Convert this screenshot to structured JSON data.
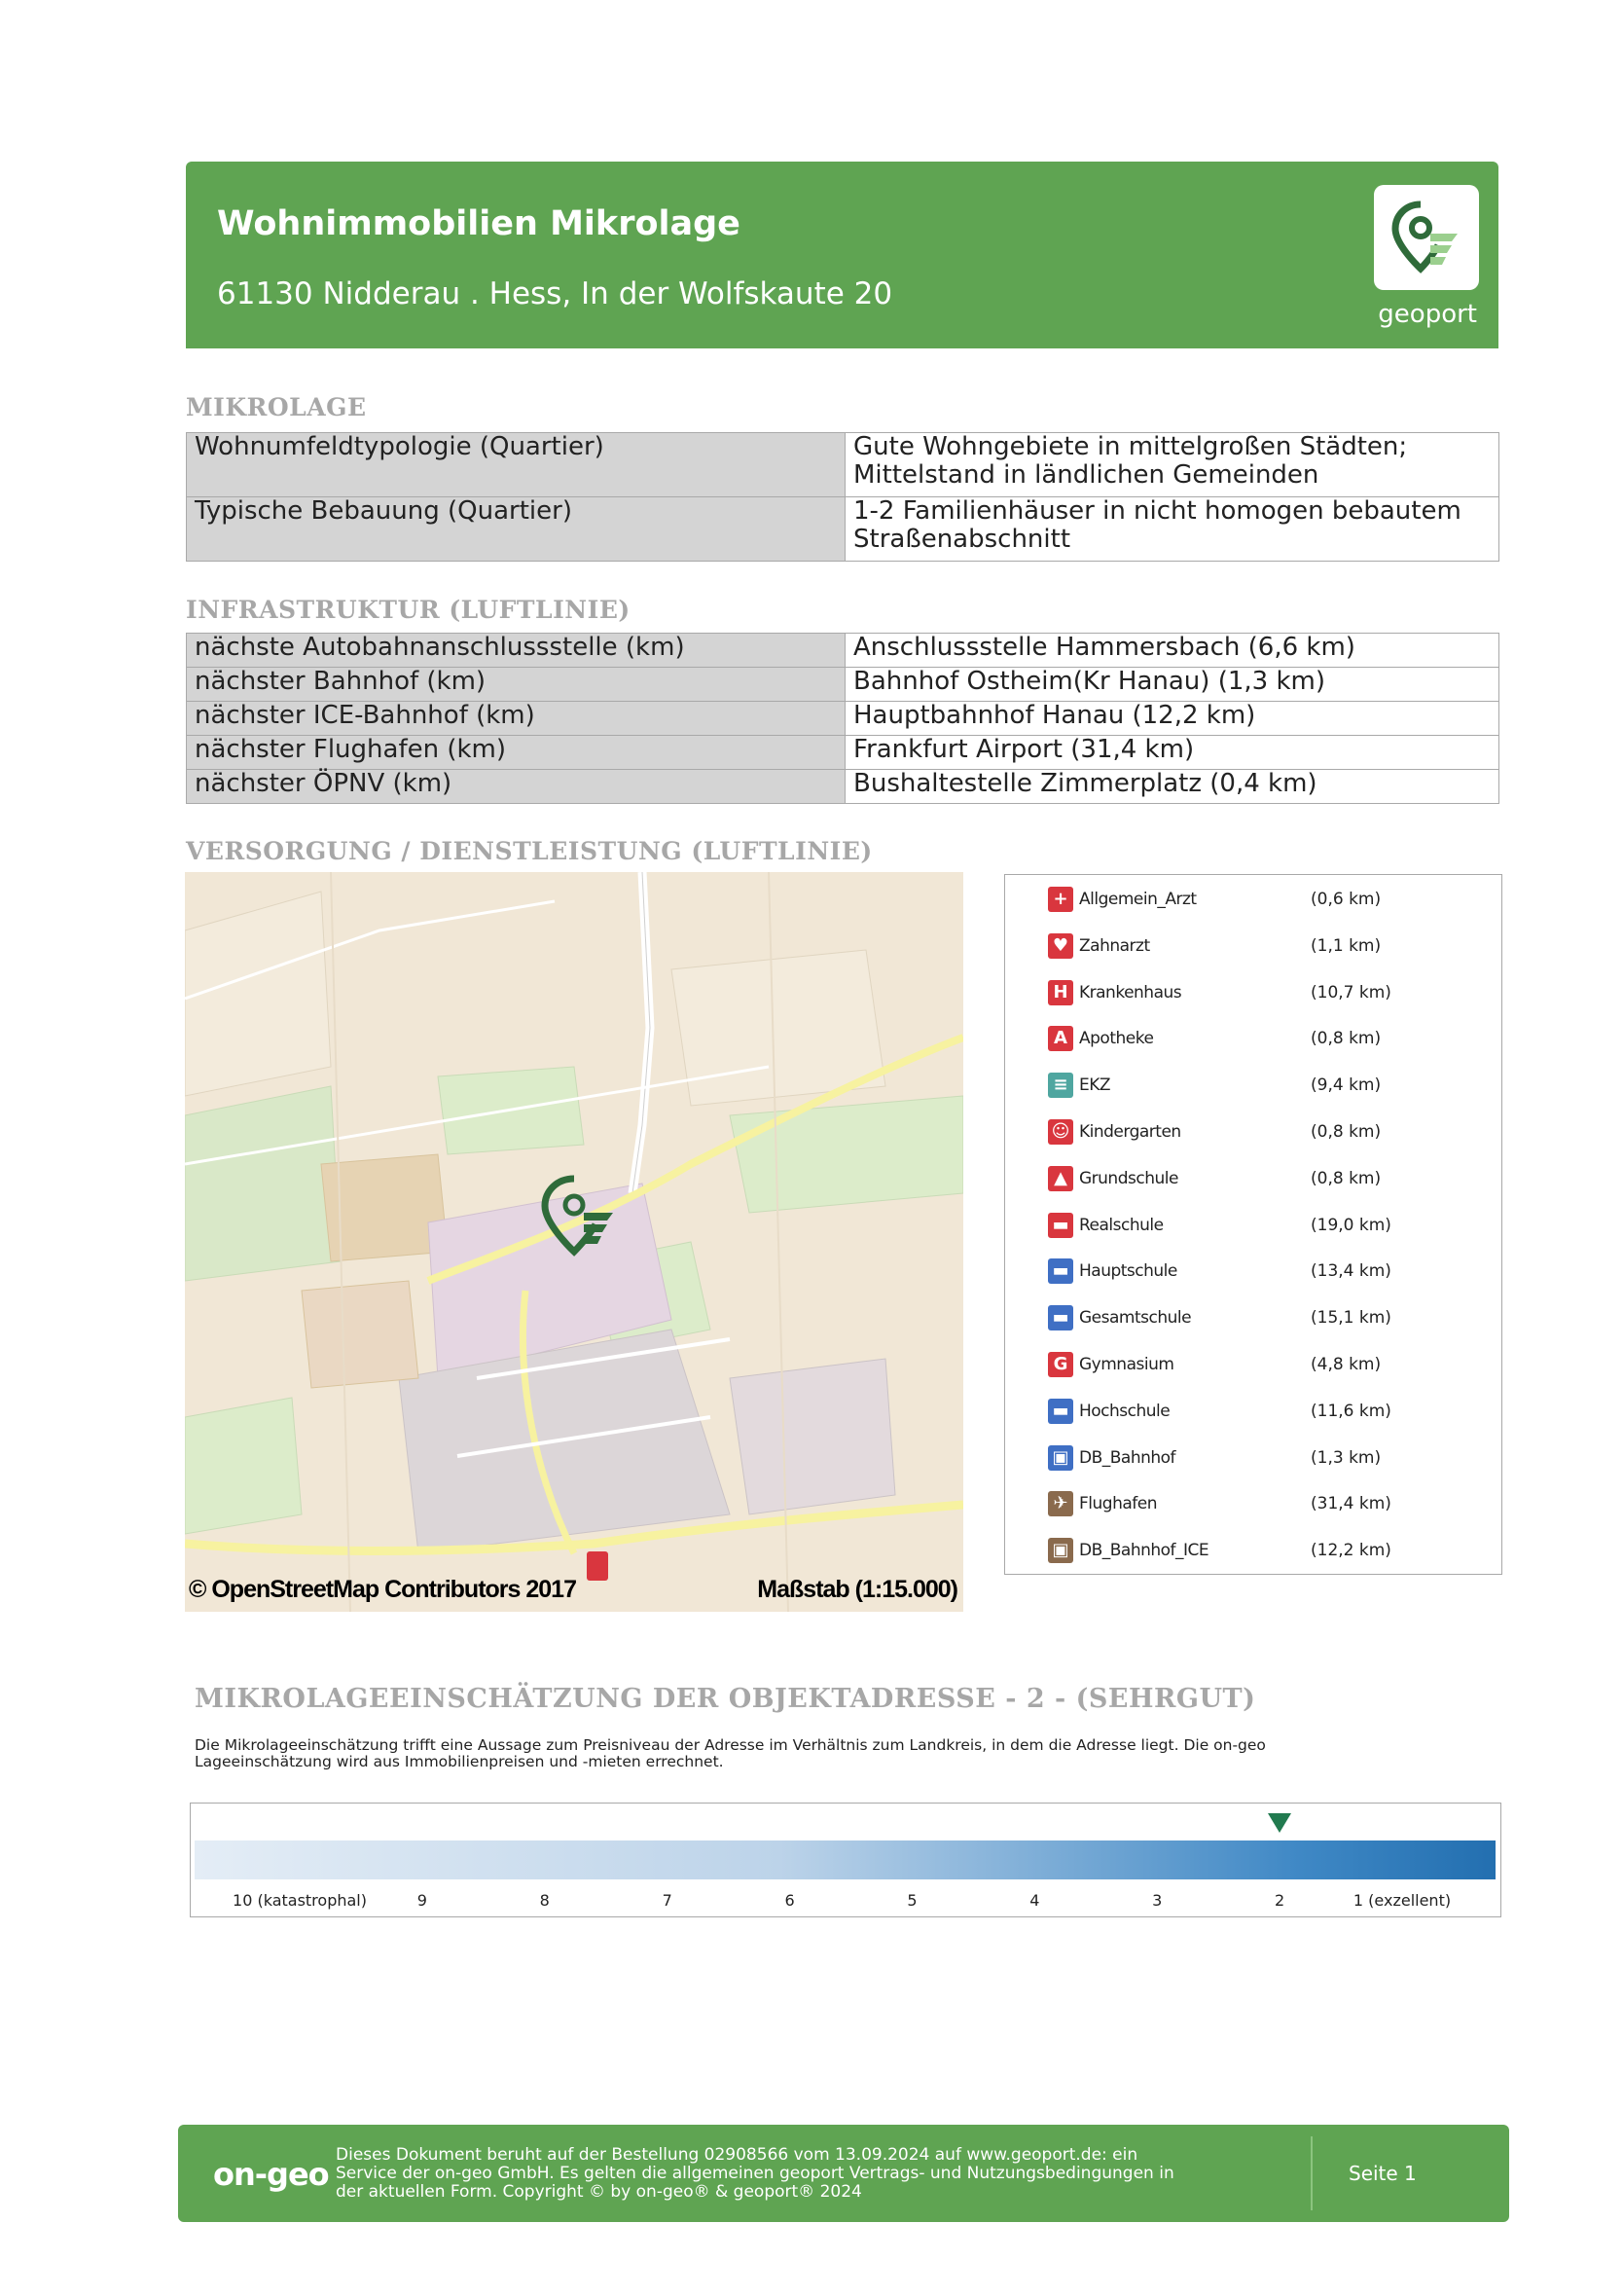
{
  "header": {
    "title": "Wohnimmobilien Mikrolage",
    "address": "61130 Nidderau . Hess, In der Wolfskaute 20",
    "logo_text": "geoport"
  },
  "mikrolage": {
    "heading": "MIKROLAGE",
    "rows": [
      {
        "key": "Wohnumfeldtypologie (Quartier)",
        "value_l1": "Gute Wohngebiete in mittelgroßen Städten;",
        "value_l2": "Mittelstand in ländlichen Gemeinden"
      },
      {
        "key": "Typische Bebauung (Quartier)",
        "value_l1": "1-2 Familienhäuser in nicht homogen bebautem",
        "value_l2": "Straßenabschnitt"
      }
    ]
  },
  "infrastruktur": {
    "heading": "INFRASTRUKTUR (LUFTLINIE)",
    "rows": [
      {
        "key": "nächste Autobahnanschlussstelle (km)",
        "value": "Anschlussstelle Hammersbach (6,6 km)"
      },
      {
        "key": "nächster Bahnhof (km)",
        "value": "Bahnhof Ostheim(Kr Hanau) (1,3 km)"
      },
      {
        "key": "nächster ICE-Bahnhof (km)",
        "value": "Hauptbahnhof Hanau (12,2 km)"
      },
      {
        "key": "nächster Flughafen (km)",
        "value": "Frankfurt Airport (31,4 km)"
      },
      {
        "key": "nächster ÖPNV (km)",
        "value": "Bushaltestelle Zimmerplatz (0,4 km)"
      }
    ]
  },
  "versorgung": {
    "heading": "VERSORGUNG / DIENSTLEISTUNG (LUFTLINIE)",
    "map_credit": "© OpenStreetMap Contributors 2017",
    "map_scale": "Maßstab (1:15.000)",
    "pois": [
      {
        "name": "Allgemein_Arzt",
        "distance": "(0,6 km)",
        "color": "#d9363e",
        "icon": "doctor-icon",
        "glyph": "+"
      },
      {
        "name": "Zahnarzt",
        "distance": "(1,1 km)",
        "color": "#d9363e",
        "icon": "tooth-icon",
        "glyph": "♥"
      },
      {
        "name": "Krankenhaus",
        "distance": "(10,7 km)",
        "color": "#d9363e",
        "icon": "hospital-icon",
        "glyph": "H"
      },
      {
        "name": "Apotheke",
        "distance": "(0,8 km)",
        "color": "#d9363e",
        "icon": "pharmacy-icon",
        "glyph": "A"
      },
      {
        "name": "EKZ",
        "distance": "(9,4 km)",
        "color": "#4fa6a0",
        "icon": "shopping-icon",
        "glyph": "≡"
      },
      {
        "name": "Kindergarten",
        "distance": "(0,8 km)",
        "color": "#d9363e",
        "icon": "kindergarten-icon",
        "glyph": "☺"
      },
      {
        "name": "Grundschule",
        "distance": "(0,8 km)",
        "color": "#d9363e",
        "icon": "primary-school-icon",
        "glyph": "▲"
      },
      {
        "name": "Realschule",
        "distance": "(19,0 km)",
        "color": "#d9363e",
        "icon": "realschule-icon",
        "glyph": "▬"
      },
      {
        "name": "Hauptschule",
        "distance": "(13,4 km)",
        "color": "#3f6fc4",
        "icon": "hauptschule-icon",
        "glyph": "▬"
      },
      {
        "name": "Gesamtschule",
        "distance": "(15,1 km)",
        "color": "#3f6fc4",
        "icon": "gesamtschule-icon",
        "glyph": "▬"
      },
      {
        "name": "Gymnasium",
        "distance": "(4,8 km)",
        "color": "#d9363e",
        "icon": "gymnasium-icon",
        "glyph": "G"
      },
      {
        "name": "Hochschule",
        "distance": "(11,6 km)",
        "color": "#3f6fc4",
        "icon": "university-icon",
        "glyph": "▬"
      },
      {
        "name": "DB_Bahnhof",
        "distance": "(1,3 km)",
        "color": "#3f6fc4",
        "icon": "train-station-icon",
        "glyph": "▣"
      },
      {
        "name": "Flughafen",
        "distance": "(31,4 km)",
        "color": "#8a6a4d",
        "icon": "airport-icon",
        "glyph": "✈"
      },
      {
        "name": "DB_Bahnhof_ICE",
        "distance": "(12,2 km)",
        "color": "#8a6a4d",
        "icon": "ice-station-icon",
        "glyph": "▣"
      }
    ]
  },
  "assessment": {
    "title": "MIKROLAGEEINSCHÄTZUNG DER OBJEKTADRESSE - 2 - (SEHRGUT)",
    "desc_l1": "Die Mikrolageeinschätzung trifft eine Aussage zum Preisniveau der Adresse im Verhältnis zum Landkreis, in dem die Adresse liegt. Die on-geo",
    "desc_l2": "Lageeinschätzung wird aus Immobilienpreisen und -mieten errechnet.",
    "rating": 2,
    "scale_labels": [
      "10 (katastrophal)",
      "9",
      "8",
      "7",
      "6",
      "5",
      "4",
      "3",
      "2",
      "1 (exzellent)"
    ]
  },
  "footer": {
    "logo": "on-geo",
    "text_l1": "Dieses Dokument beruht auf der Bestellung 02908566 vom 13.09.2024 auf www.geoport.de: ein",
    "text_l2": "Service der on-geo GmbH. Es gelten die allgemeinen geoport Vertrags- und Nutzungsbedingungen in",
    "text_l3": "der aktuellen Form. Copyright © by on-geo® & geoport® 2024",
    "page": "Seite 1"
  }
}
